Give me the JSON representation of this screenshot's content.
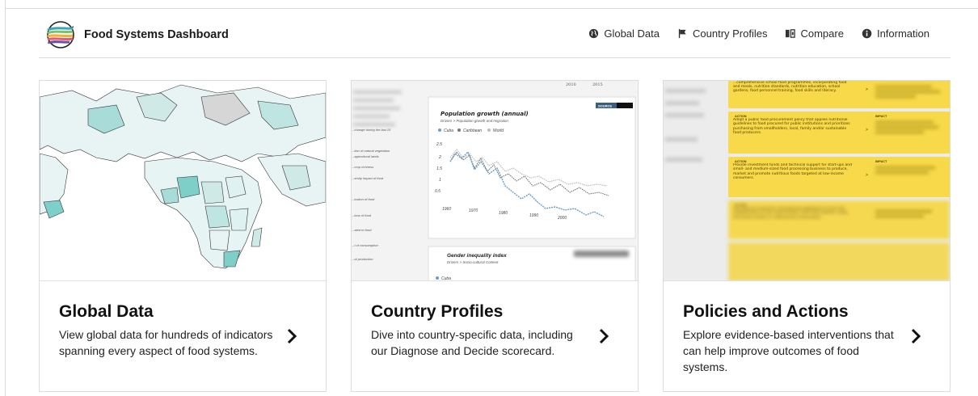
{
  "header": {
    "brand": "Food Systems Dashboard",
    "nav": [
      {
        "label": "Global Data",
        "icon": "globe-icon"
      },
      {
        "label": "Country Profiles",
        "icon": "flag-icon"
      },
      {
        "label": "Compare",
        "icon": "compare-icon"
      },
      {
        "label": "Information",
        "icon": "info-icon"
      }
    ]
  },
  "cards": [
    {
      "title": "Global Data",
      "description": "View global data for hundreds of indicators spanning every aspect of food systems."
    },
    {
      "title": "Country Profiles",
      "description": "Dive into country-specific data, including our Diagnose and Decide scorecard.",
      "preview": {
        "chart_title": "Population growth (annual)",
        "chart_subtitle": "Drivers > Population growth and migration",
        "legend": [
          "Cuba",
          "Caribbean",
          "World"
        ],
        "y_ticks": [
          "2.5",
          "2",
          "1.5",
          "1",
          "0.5"
        ],
        "x_ticks": [
          "1960",
          "1970",
          "1980",
          "1990",
          "2000"
        ],
        "second_title": "Gender inequality index",
        "second_subtitle": "Drivers > Socio-cultural Context",
        "second_legend": "Cuba",
        "badge": "SOURCE",
        "top_years": [
          "2010",
          "2015"
        ],
        "side_labels": [
          "...change during the last 10",
          "...tion of natural vegetation",
          "...agricultural lands",
          "...crop richness",
          "...ersity impact of food",
          "...ication of food",
          "...ions of food",
          "...ated to food",
          "...t of consumption",
          "...of production"
        ]
      }
    },
    {
      "title": "Policies and Actions",
      "description": "Explore evidence-based interventions that can help improve outcomes of food systems.",
      "preview": {
        "action_label": "ACTION",
        "impact_label": "IMPACT",
        "actions": [
          "...comprehensive school food programmes, incorporating food and meals, nutrition standards, nutrition education, school gardens, food personnel training, food skills and literacy.",
          "Adopt a public food procurement policy that applies nutritional guidelines to food procured for public institutions and prioritizes purchasing from smallholders, local, family and/or sustainable food producers.",
          "Provide investment funds and technical support for start-ups and small- and medium-sized food processing business to produce, market and promote nutritious foods targeted at low-income consumers.",
          "Use financial incentives and planning regulations to drive the establishment of new supermarkets, fresh food markets, shops and street vendors in underserved communities."
        ]
      }
    }
  ],
  "colors": {
    "accent_yellow": "#f7d94a",
    "map_teal": "#5cc4be",
    "map_light": "#dff1f0",
    "chart_blue": "#6a9dc8"
  }
}
